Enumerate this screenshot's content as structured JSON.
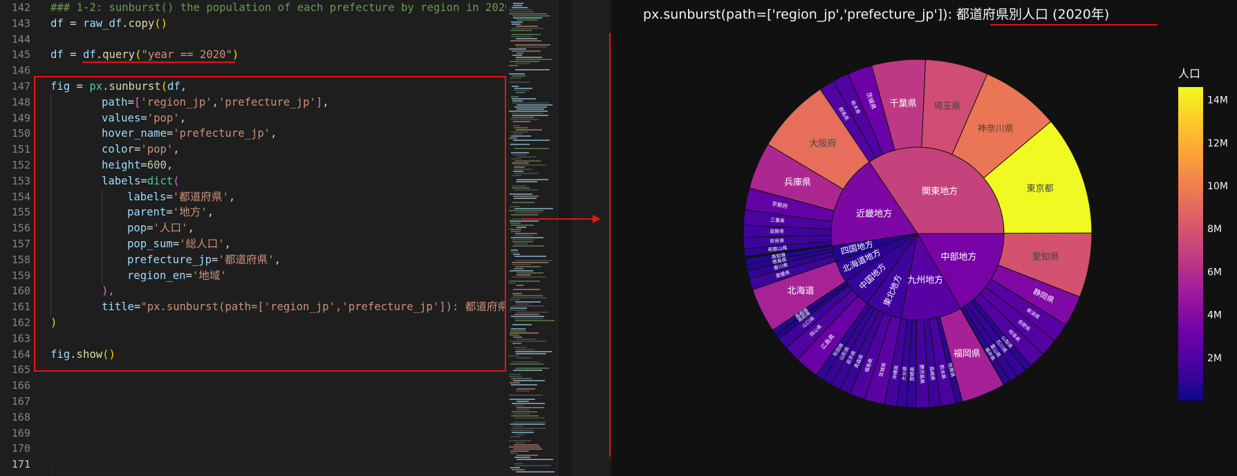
{
  "editor": {
    "line_numbers": [
      "142",
      "143",
      "144",
      "145",
      "146",
      "147",
      "148",
      "149",
      "150",
      "151",
      "152",
      "153",
      "154",
      "155",
      "156",
      "157",
      "158",
      "159",
      "160",
      "161",
      "162",
      "163",
      "164",
      "165",
      "166",
      "167",
      "168",
      "169",
      "170",
      "171"
    ],
    "active_line": "171",
    "code": {
      "l142": "### 1-2: sunburst() the population of each prefecture by region in 2020",
      "l143_a": "df",
      "l143_b": " = ",
      "l143_c": "raw_df",
      "l143_d": ".copy",
      "l143_e": "()",
      "l145_a": "df",
      "l145_b": " = ",
      "l145_c": "df",
      "l145_d": ".query",
      "l145_e": "(",
      "l145_f": "\"year == 2020\"",
      "l145_g": ")",
      "l147_a": "fig",
      "l147_b": " = ",
      "l147_c": "px",
      "l147_d": ".sunburst",
      "l147_e": "(",
      "l147_f": "df,",
      "l148_a": "path",
      "l148_b": "=",
      "l148_c": "[",
      "l148_d": "'region_jp'",
      "l148_e": ",",
      "l148_f": "'prefecture_jp'",
      "l148_g": "]",
      "l148_h": ",",
      "l149_a": "values",
      "l149_b": "=",
      "l149_c": "'pop'",
      "l149_d": ",",
      "l150_a": "hover_name",
      "l150_b": "=",
      "l150_c": "'prefecture_jp'",
      "l150_d": ",",
      "l151_a": "color",
      "l151_b": "=",
      "l151_c": "'pop'",
      "l151_d": ",",
      "l152_a": "height",
      "l152_b": "=",
      "l152_c": "600",
      "l152_d": ",",
      "l153_a": "labels",
      "l153_b": "=",
      "l153_c": "dict",
      "l153_d": "(",
      "l154_a": "labels",
      "l154_b": "=",
      "l154_c": "'都道府県'",
      "l154_d": ",",
      "l155_a": "parent",
      "l155_b": "=",
      "l155_c": "'地方'",
      "l155_d": ",",
      "l156_a": "pop",
      "l156_b": "=",
      "l156_c": "'人口'",
      "l156_d": ",",
      "l157_a": "pop_sum",
      "l157_b": "=",
      "l157_c": "'総人口'",
      "l157_d": ",",
      "l158_a": "prefecture_jp",
      "l158_b": "=",
      "l158_c": "'都道府県'",
      "l158_d": ",",
      "l159_a": "region_en",
      "l159_b": "=",
      "l159_c": "'地域'",
      "l160_a": "),",
      "l161_a": "title",
      "l161_b": "=",
      "l161_c": "\"px.sunburst(path=['region_jp','prefecture_jp']): 都道府県",
      "l162_a": ")",
      "l164_a": "fig",
      "l164_b": ".show",
      "l164_c": "()"
    }
  },
  "figure": {
    "title": "px.sunburst(path=['region_jp','prefecture_jp']): 都道府県別人口 (2020年)",
    "colorbar": {
      "title": "人口",
      "ticks": [
        "14M",
        "12M",
        "10M",
        "8M",
        "6M",
        "4M",
        "2M"
      ],
      "colors": [
        "#0d0887",
        "#46039f",
        "#7201a8",
        "#9c179e",
        "#bd3786",
        "#d8576b",
        "#ed7953",
        "#fb9f3a",
        "#fdca26",
        "#f0f921"
      ]
    },
    "regions": [
      {
        "name": "関東地方",
        "value": 43.47,
        "children": [
          [
            "東京都",
            14.05
          ],
          [
            "神奈川県",
            9.24
          ],
          [
            "埼玉県",
            7.34
          ],
          [
            "千葉県",
            6.28
          ],
          [
            "茨城県",
            2.87
          ],
          [
            "栃木県",
            1.93
          ],
          [
            "群馬県",
            1.94
          ]
        ]
      },
      {
        "name": "近畿地方",
        "value": 22.54,
        "children": [
          [
            "大阪府",
            8.84
          ],
          [
            "兵庫県",
            5.47
          ],
          [
            "京都府",
            2.58
          ],
          [
            "三重県",
            1.77
          ],
          [
            "滋賀県",
            1.41
          ],
          [
            "奈良県",
            1.32
          ],
          [
            "和歌山県",
            0.92
          ]
        ]
      },
      {
        "name": "四国地方",
        "value": 3.7,
        "children": [
          [
            "高知県",
            0.69
          ],
          [
            "徳島県",
            0.72
          ],
          [
            "香川県",
            0.95
          ],
          [
            "愛媛県",
            1.33
          ]
        ]
      },
      {
        "name": "北海道地方",
        "value": 5.22,
        "children": [
          [
            "北海道",
            5.22
          ]
        ]
      },
      {
        "name": "中国地方",
        "value": 7.26,
        "children": [
          [
            "島根県",
            0.67
          ],
          [
            "鳥取県",
            0.55
          ],
          [
            "山口県",
            1.34
          ],
          [
            "岡山県",
            1.88
          ],
          [
            "広島県",
            2.8
          ]
        ]
      },
      {
        "name": "東北地方",
        "value": 8.61,
        "children": [
          [
            "秋田県",
            0.96
          ],
          [
            "山形県",
            1.06
          ],
          [
            "岩手県",
            1.21
          ],
          [
            "青森県",
            1.24
          ],
          [
            "福島県",
            1.83
          ],
          [
            "宮城県",
            2.3
          ]
        ]
      },
      {
        "name": "九州地方",
        "value": 14.33,
        "children": [
          [
            "沖縄県",
            1.47
          ],
          [
            "大分県",
            1.12
          ],
          [
            "宮崎県",
            1.07
          ],
          [
            "鹿児島県",
            1.59
          ],
          [
            "長崎県",
            1.31
          ],
          [
            "熊本県",
            1.74
          ],
          [
            "佐賀県",
            0.81
          ],
          [
            "福岡県",
            5.14
          ]
        ]
      },
      {
        "name": "中部地方",
        "value": 21.08,
        "children": [
          [
            "福井県",
            0.77
          ],
          [
            "富山県",
            1.03
          ],
          [
            "石川県",
            1.13
          ],
          [
            "山梨県",
            0.81
          ],
          [
            "岐阜県",
            1.98
          ],
          [
            "長野県",
            2.05
          ],
          [
            "新潟県",
            2.2
          ],
          [
            "静岡県",
            3.63
          ],
          [
            "愛知県",
            7.54
          ]
        ]
      }
    ]
  }
}
